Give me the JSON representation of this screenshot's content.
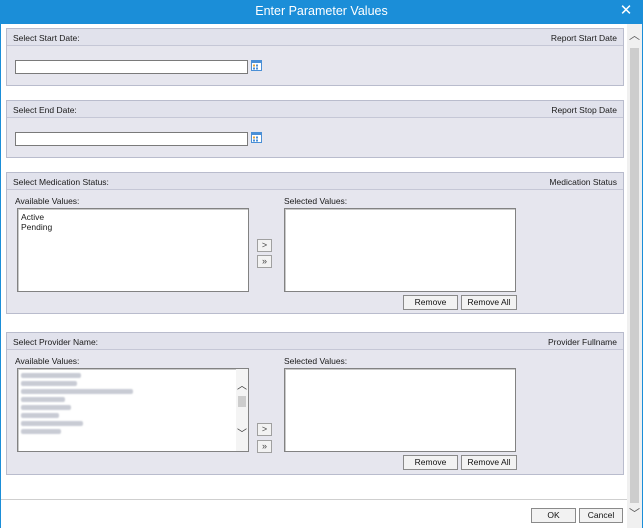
{
  "window": {
    "title": "Enter Parameter Values",
    "close_symbol": "✕"
  },
  "sections": {
    "start_date": {
      "label": "Select Start Date:",
      "right_label": "Report Start Date",
      "value": ""
    },
    "end_date": {
      "label": "Select End Date:",
      "right_label": "Report Stop Date",
      "value": ""
    },
    "medication_status": {
      "label": "Select Medication Status:",
      "right_label": "Medication Status",
      "available_label": "Available Values:",
      "selected_label": "Selected Values:",
      "available_values": [
        "Active",
        "Pending"
      ],
      "selected_values": [],
      "add_symbol": ">",
      "add_all_symbol": "»",
      "remove_label": "Remove",
      "remove_all_label": "Remove All"
    },
    "provider_name": {
      "label": "Select Provider Name:",
      "right_label": "Provider Fullname",
      "available_label": "Available Values:",
      "selected_label": "Selected Values:",
      "selected_values": [],
      "add_symbol": ">",
      "add_all_symbol": "»",
      "remove_label": "Remove",
      "remove_all_label": "Remove All"
    }
  },
  "footer": {
    "ok_label": "OK",
    "cancel_label": "Cancel"
  },
  "icons": {
    "calendar": "calendar-icon",
    "scroll_up": "chevron-up-icon",
    "scroll_down": "chevron-down-icon"
  },
  "colors": {
    "title_bar": "#1b8ed8",
    "section_bg": "#e6e6ee",
    "calendar_icon": "#4a8fd6"
  }
}
